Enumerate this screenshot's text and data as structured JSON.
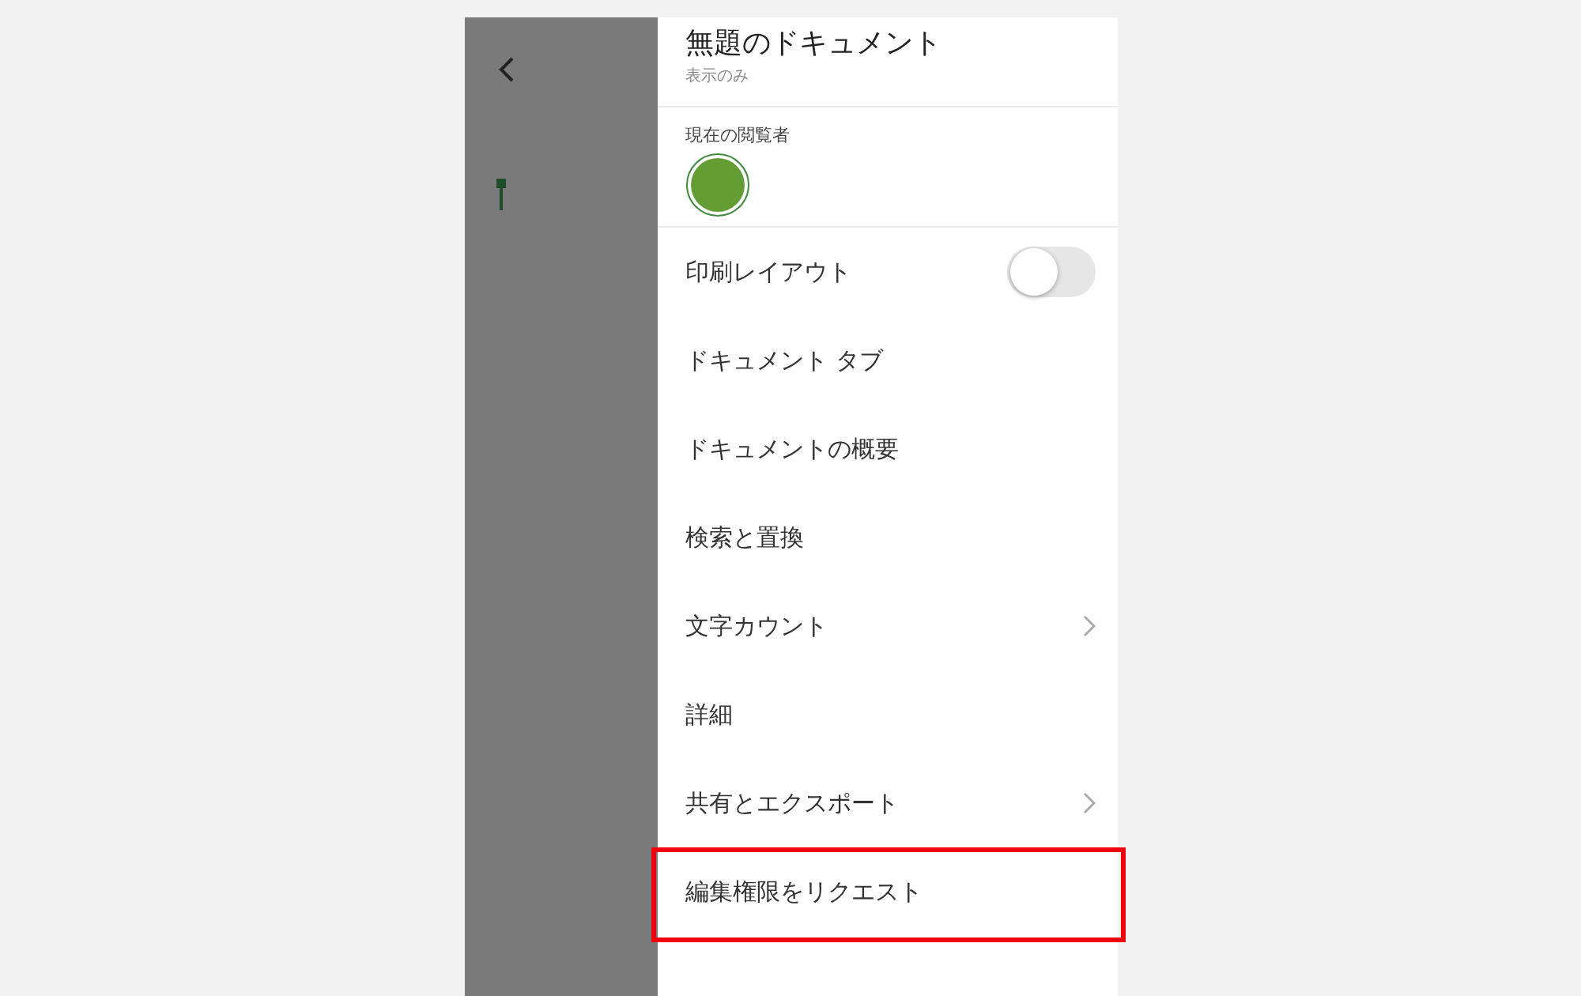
{
  "document": {
    "title": "無題のドキュメント",
    "subtitle": "表示のみ"
  },
  "viewers": {
    "label": "現在の閲覧者",
    "avatars": [
      {
        "color": "#639d33"
      }
    ]
  },
  "menu": [
    {
      "label": "印刷レイアウト",
      "kind": "toggle",
      "on": false,
      "highlighted": false
    },
    {
      "label": "ドキュメント タブ",
      "kind": "plain",
      "highlighted": false
    },
    {
      "label": "ドキュメントの概要",
      "kind": "plain",
      "highlighted": false
    },
    {
      "label": "検索と置換",
      "kind": "plain",
      "highlighted": false
    },
    {
      "label": "文字カウント",
      "kind": "submenu",
      "highlighted": false
    },
    {
      "label": "詳細",
      "kind": "plain",
      "highlighted": false
    },
    {
      "label": "共有とエクスポート",
      "kind": "submenu",
      "highlighted": false
    },
    {
      "label": "編集権限をリクエスト",
      "kind": "plain",
      "highlighted": true
    }
  ]
}
